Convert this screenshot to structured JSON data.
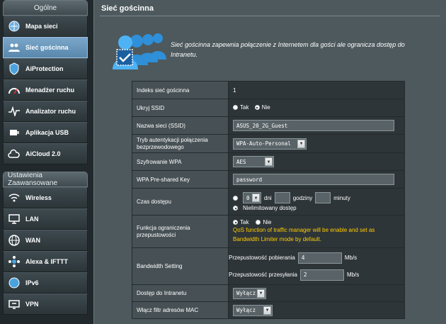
{
  "sidebar": {
    "general_header": "Ogólne",
    "general_items": [
      {
        "label": "Mapa sieci",
        "icon": "network-map-icon"
      },
      {
        "label": "Sieć gościnna",
        "icon": "guest-network-icon",
        "active": true
      },
      {
        "label": "AiProtection",
        "icon": "shield-icon"
      },
      {
        "label": "Menadżer ruchu",
        "icon": "speedometer-icon"
      },
      {
        "label": "Analizator ruchu",
        "icon": "pulse-icon"
      },
      {
        "label": "Aplikacja USB",
        "icon": "usb-icon"
      },
      {
        "label": "AiCloud 2.0",
        "icon": "cloud-icon"
      }
    ],
    "advanced_header": "Ustawienia Zaawansowane",
    "advanced_items": [
      {
        "label": "Wireless",
        "icon": "wireless-icon"
      },
      {
        "label": "LAN",
        "icon": "lan-icon"
      },
      {
        "label": "WAN",
        "icon": "globe-icon"
      },
      {
        "label": "Alexa & IFTTT",
        "icon": "alexa-icon"
      },
      {
        "label": "IPv6",
        "icon": "ipv6-icon"
      },
      {
        "label": "VPN",
        "icon": "vpn-icon"
      }
    ]
  },
  "main": {
    "title": "Sieć gościnna",
    "description": "Sieć gościnna zapewnia połączenie z Internetem dla gości ale ogranicza dostęp do Intranetu.",
    "rows": {
      "index": {
        "label": "Indeks sieć gościnna",
        "value": "1"
      },
      "hide_ssid": {
        "label": "Ukryj SSID",
        "opt_yes": "Tak",
        "opt_no": "Nie"
      },
      "ssid": {
        "label": "Nazwa sieci (SSID)",
        "value": "ASUS_20_2G_Guest"
      },
      "auth": {
        "label": "Tryb autentykacji połączenia bezprzewodowego",
        "value": "WPA-Auto-Personal"
      },
      "enc": {
        "label": "Szyfrowanie WPA",
        "value": "AES"
      },
      "psk": {
        "label": "WPA Pre-shared Key",
        "value": "password"
      },
      "access_time": {
        "label": "Czas dostępu",
        "days_value": "0",
        "days": "dni",
        "hours": "godziny",
        "minutes": "minuty",
        "unlimited": "Nielimitowany dostęp"
      },
      "qos": {
        "label": "Funkcja ograniczenia przepustowości",
        "opt_yes": "Tak",
        "opt_no": "Nie",
        "note": "QoS function of traffic manager will be enable and set as Bandwidth Limiter mode by default."
      },
      "bandwidth": {
        "label": "Bandwidth Setting",
        "down_label": "Przepustowość pobierania",
        "down_value": "4",
        "up_label": "Przepustowość przesyłania",
        "up_value": "2",
        "unit": "Mb/s"
      },
      "intranet": {
        "label": "Dostęp do Intranetu",
        "value": "Wyłącz"
      },
      "mac": {
        "label": "Włącz filtr adresów MAC",
        "value": "Wyłącz"
      }
    }
  },
  "colors": {
    "accent": "#5988ad",
    "warning": "#ffcc00",
    "panel": "#4d595d"
  }
}
